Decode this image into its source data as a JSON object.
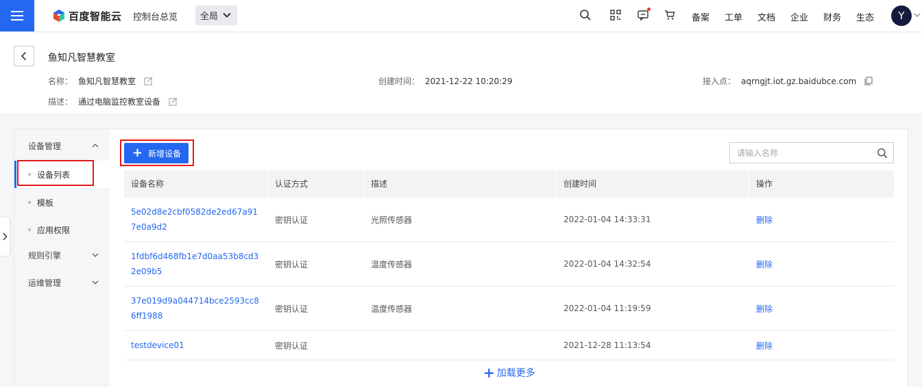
{
  "topbar": {
    "brand": "百度智能云",
    "overview": "控制台总览",
    "region": "全局",
    "links": [
      "备案",
      "工单",
      "文档",
      "企业",
      "财务",
      "生态"
    ],
    "avatar_letter": "Y",
    "accent": "#2468f2"
  },
  "header": {
    "title": "鱼知凡智慧教室",
    "name_label": "名称：",
    "name_value": "鱼知凡智慧教室",
    "created_label": "创建时间：",
    "created_value": "2021-12-22 10:20:29",
    "endpoint_label": "接入点：",
    "endpoint_value": "aqrngjt.iot.gz.baidubce.com",
    "desc_label": "描述：",
    "desc_value": "通过电脑监控教室设备"
  },
  "sidebar": {
    "group_device": "设备管理",
    "item_list": "设备列表",
    "item_template": "模板",
    "item_permission": "应用权限",
    "group_rules": "规则引擎",
    "group_ops": "运维管理"
  },
  "toolbar": {
    "add_label": "新增设备",
    "search_placeholder": "请输入名称"
  },
  "table": {
    "headers": [
      "设备名称",
      "认证方式",
      "描述",
      "创建时间",
      "操作"
    ],
    "rows": [
      {
        "name": "5e02d8e2cbf0582de2ed67a917e0a9d2",
        "auth": "密钥认证",
        "desc": "光照传感器",
        "time": "2022-01-04 14:33:31",
        "action": "删除"
      },
      {
        "name": "1fdbf6d468fb1e7d0aa53b8cd32e09b5",
        "auth": "密钥认证",
        "desc": "温度传感器",
        "time": "2022-01-04 14:32:54",
        "action": "删除"
      },
      {
        "name": "37e019d9a044714bce2593cc86ff1988",
        "auth": "密钥认证",
        "desc": "温度传感器",
        "time": "2022-01-04 11:19:59",
        "action": "删除"
      },
      {
        "name": "testdevice01",
        "auth": "密钥认证",
        "desc": "",
        "time": "2021-12-28 11:13:54",
        "action": "删除"
      }
    ]
  },
  "load_more": "加载更多"
}
